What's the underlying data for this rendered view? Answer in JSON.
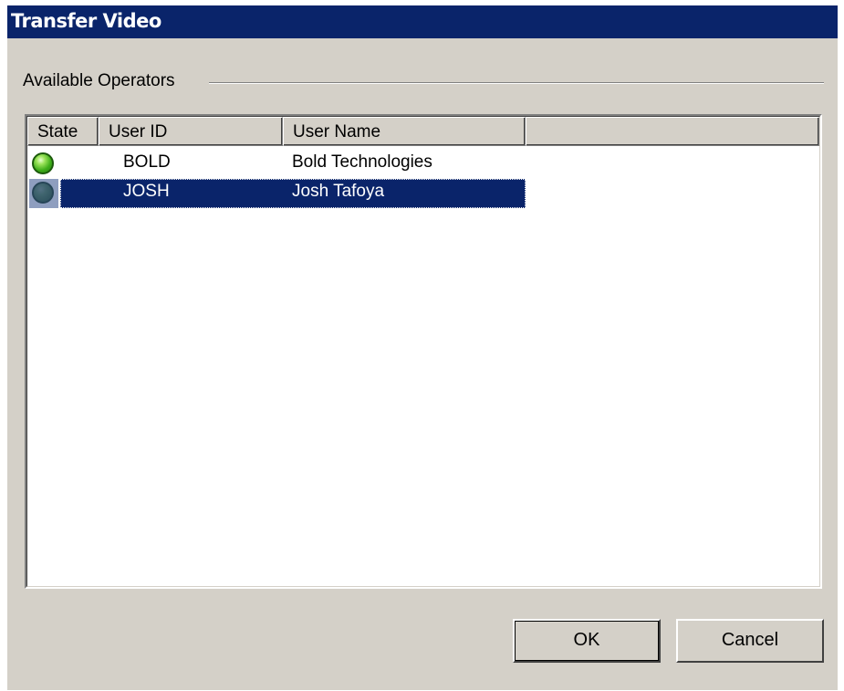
{
  "window": {
    "title": "Transfer Video"
  },
  "group": {
    "label": "Available Operators"
  },
  "list": {
    "columns": [
      "State",
      "User ID",
      "User Name",
      ""
    ],
    "rows": [
      {
        "state_icon": "green-status-icon",
        "user_id": "BOLD",
        "user_name": "Bold Technologies",
        "selected": false
      },
      {
        "state_icon": "green-status-icon",
        "user_id": "JOSH",
        "user_name": "Josh Tafoya",
        "selected": true
      }
    ]
  },
  "buttons": {
    "ok": "OK",
    "cancel": "Cancel"
  },
  "colors": {
    "titlebar": "#0a246a",
    "selection": "#0a246a",
    "dialog_bg": "#d4d0c8"
  }
}
